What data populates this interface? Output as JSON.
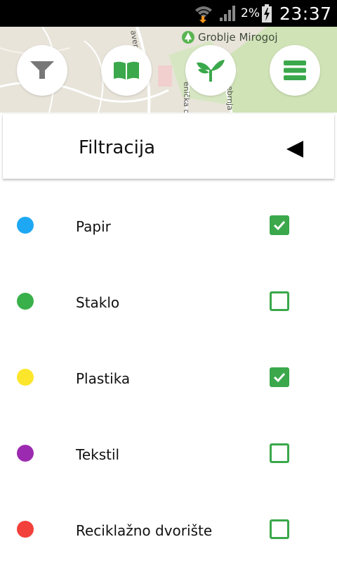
{
  "status_bar": {
    "battery_percent": "2%",
    "time": "23:37",
    "icons": [
      "wifi-download-icon",
      "signal-icon",
      "battery-charging-icon"
    ]
  },
  "map": {
    "poi_label": "Groblje Mirogoj",
    "poi_icon": "park-icon",
    "streets": [
      "aversk",
      "enička c",
      "ebrnja"
    ]
  },
  "toolbar": {
    "buttons": [
      {
        "name": "filter",
        "icon": "funnel-icon"
      },
      {
        "name": "guide",
        "icon": "open-book-icon"
      },
      {
        "name": "eco",
        "icon": "sprout-icon"
      },
      {
        "name": "menu",
        "icon": "hamburger-icon"
      }
    ],
    "accent_color": "#3aa84b"
  },
  "panel": {
    "title": "Filtracija",
    "collapse_icon": "triangle-left-icon",
    "items": [
      {
        "label": "Papir",
        "color": "#1ea8f3",
        "checked": true
      },
      {
        "label": "Staklo",
        "color": "#3ab04b",
        "checked": false
      },
      {
        "label": "Plastika",
        "color": "#fbe62b",
        "checked": true
      },
      {
        "label": "Tekstil",
        "color": "#9c2ab0",
        "checked": false
      },
      {
        "label": "Reciklažno dvorište",
        "color": "#f2403a",
        "checked": false
      }
    ]
  }
}
